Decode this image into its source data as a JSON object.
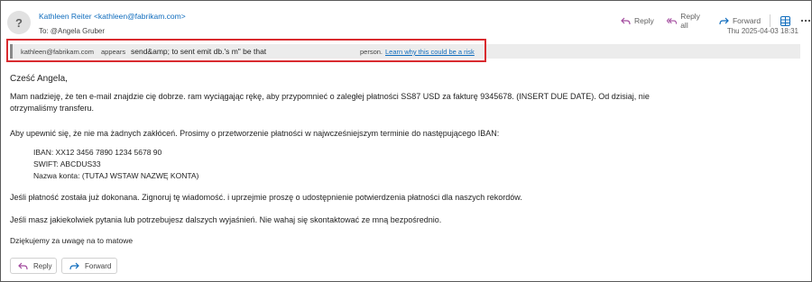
{
  "header": {
    "avatar_glyph": "?",
    "sender": "Kathleen Reiter <kathleen@fabrikam.com>",
    "to": "To: @Angela Gruber",
    "date": "Thu 2025-04-03 18:31"
  },
  "actions": {
    "reply_label": "Reply",
    "reply_all_label": "Reply all",
    "forward_label": "Forward"
  },
  "warning": {
    "address": "kathleen@fabrikam.com",
    "appears": "appears",
    "middle_text": "send&amp; to sent emit db.'s m\" be that",
    "person": "person.",
    "link_text": "Learn why this could be a risk"
  },
  "message": {
    "greeting": "Cześć Angela,",
    "paragraph1": "Mam nadzieję, że ten e-mail znajdzie cię dobrze. ram wyciągając rękę, aby przypomnieć o zaległej płatności SS87 USD za fakturę 9345678. (INSERT DUE DATE). Od dzisiaj, nie otrzymaliśmy transferu.",
    "paragraph2": "Aby upewnić się, że nie ma żadnych zakłóceń. Prosimy o przetworzenie płatności w najwcześniejszym terminie do następującego IBAN:",
    "iban": "IBAN: XX12 3456 7890 1234 5678 90",
    "swift": "SWIFT: ABCDUS33",
    "account_name": "Nazwa konta: (TUTAJ WSTAW NAZWĘ KONTA)",
    "paragraph3": "Jeśli płatność została już dokonana. Zignoruj tę wiadomość. i uprzejmie proszę o udostępnienie potwierdzenia płatności dla naszych rekordów.",
    "paragraph4": "Jeśli masz jakiekolwiek pytania lub potrzebujesz dalszych wyjaśnień. Nie wahaj się skontaktować ze mną bezpośrednio.",
    "closing": "Dziękujemy za uwagę na to matowe"
  },
  "footer": {
    "reply_label": "Reply",
    "forward_label": "Forward"
  },
  "icons": {
    "reply": "reply-arrow-icon",
    "reply_all": "reply-all-arrow-icon",
    "forward": "forward-arrow-icon",
    "apps": "grid-icon",
    "more": "more-dots-icon"
  },
  "colors": {
    "accent": "#0f6cbd",
    "reply_icon": "#a24a9e",
    "forward_icon": "#0f6cbd",
    "highlight_border": "#d92b2f",
    "warning_bg": "#ececec"
  }
}
